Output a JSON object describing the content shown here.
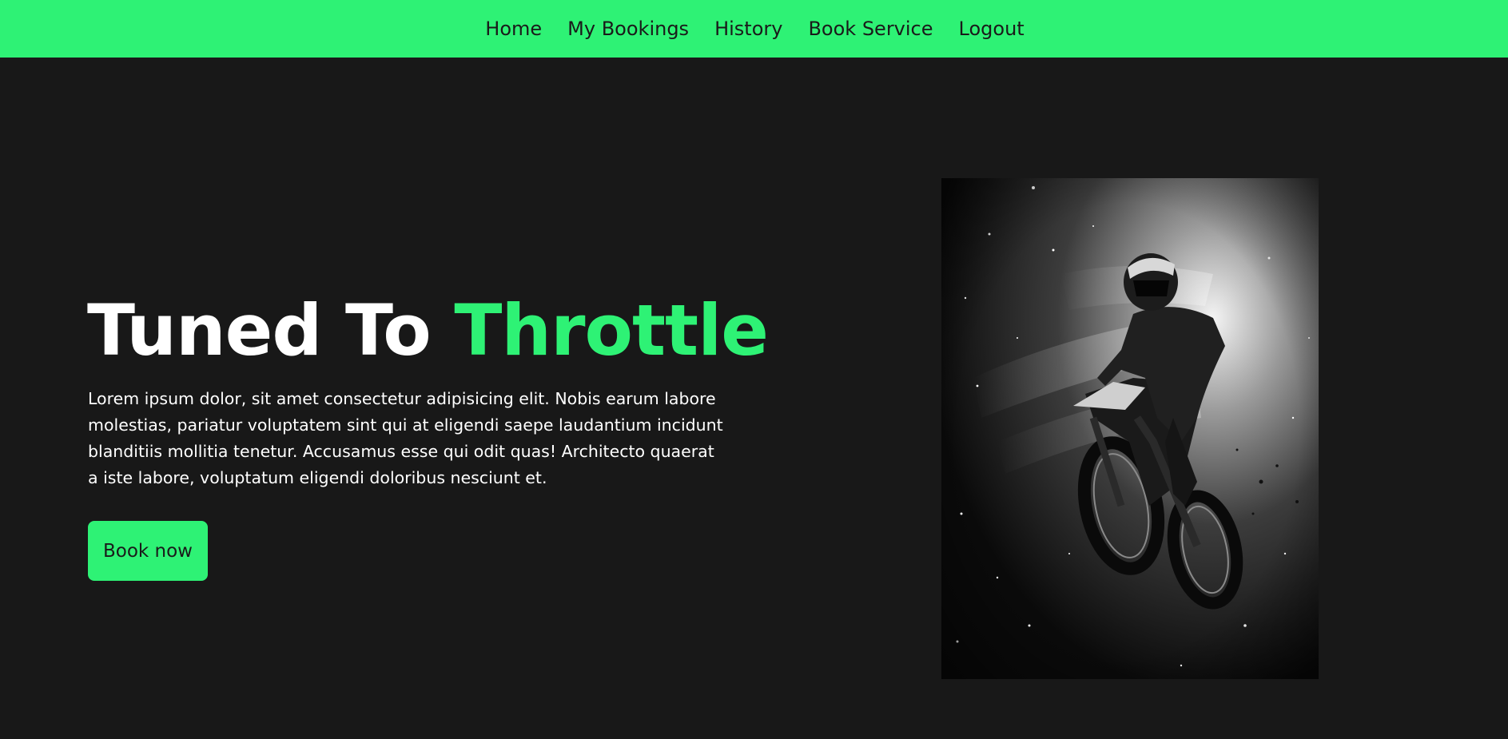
{
  "nav": {
    "items": [
      {
        "label": "Home"
      },
      {
        "label": "My Bookings"
      },
      {
        "label": "History"
      },
      {
        "label": "Book Service"
      },
      {
        "label": "Logout"
      }
    ]
  },
  "hero": {
    "title_part1": "Tuned To ",
    "title_part2": "Throttle",
    "description": "Lorem ipsum dolor, sit amet consectetur adipisicing elit. Nobis earum labore molestias, pariatur voluptatem sint qui at eligendi saepe laudantium incidunt blanditiis mollitia tenetur. Accusamus esse qui odit quas! Architecto quaerat a iste labore, voluptatum eligendi doloribus nesciunt et.",
    "cta_label": "Book now",
    "image_icon": "motocross-rider-image"
  },
  "colors": {
    "accent": "#2ef275",
    "background": "#181818",
    "text": "#ffffff",
    "nav_text": "#1a1a1a"
  }
}
